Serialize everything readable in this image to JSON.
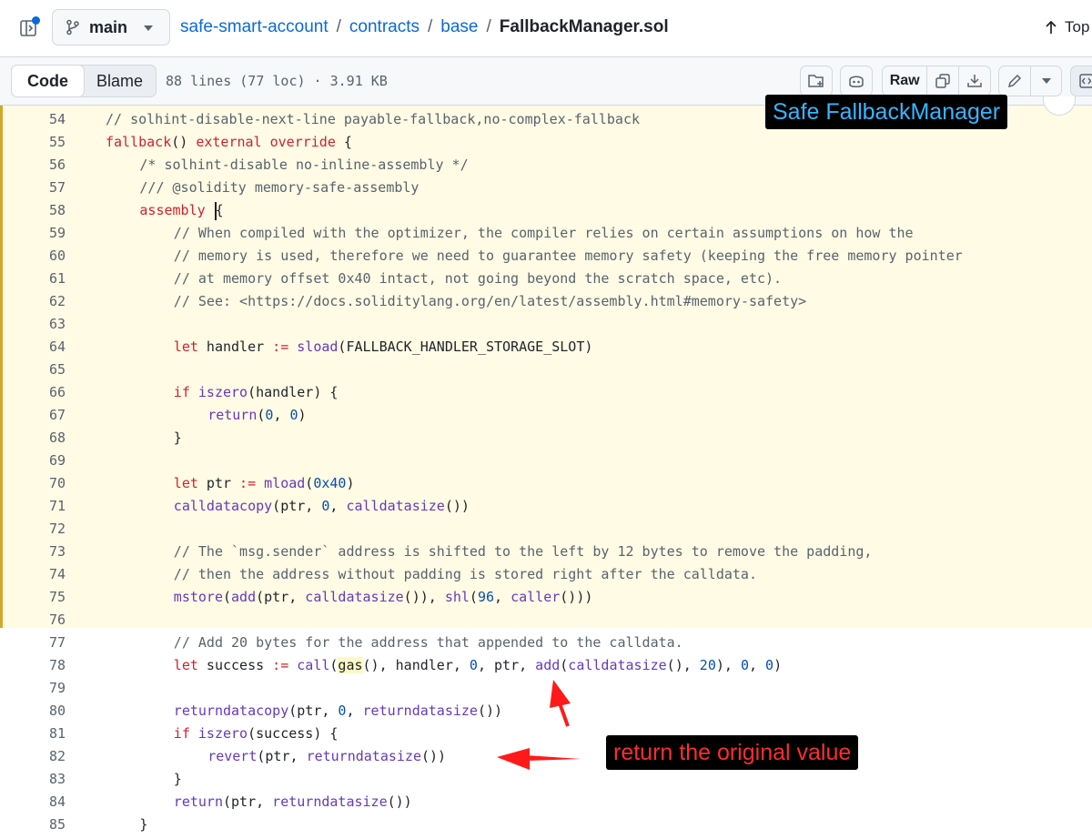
{
  "header": {
    "branch": "main",
    "breadcrumb": {
      "repo": "safe-smart-account",
      "folder1": "contracts",
      "folder2": "base",
      "file": "FallbackManager.sol",
      "sep": "/"
    },
    "top_label": "Top"
  },
  "toolbar": {
    "code_tab": "Code",
    "blame_tab": "Blame",
    "file_info": "88 lines (77 loc) · 3.91 KB",
    "raw_label": "Raw"
  },
  "annotations": {
    "title_tag": "Safe FallbackManager",
    "note_tag": "return the original value",
    "accent_blue": "#35b6ff",
    "accent_red": "#ff2d2d"
  },
  "code": {
    "highlight_color": "#fffbe5",
    "lines": [
      {
        "n": "54",
        "indent": 4,
        "tokens": [
          {
            "t": "// solhint-disable-next-line payable-fallback,no-complex-fallback",
            "c": "comment"
          }
        ]
      },
      {
        "n": "55",
        "indent": 4,
        "tokens": [
          {
            "t": "fallback",
            "c": "keyword"
          },
          {
            "t": "() ",
            "c": ""
          },
          {
            "t": "external",
            "c": "keyword"
          },
          {
            "t": " ",
            "c": ""
          },
          {
            "t": "override",
            "c": "keyword"
          },
          {
            "t": " {",
            "c": ""
          }
        ]
      },
      {
        "n": "56",
        "indent": 8,
        "tokens": [
          {
            "t": "/* solhint-disable no-inline-assembly */",
            "c": "comment"
          }
        ]
      },
      {
        "n": "57",
        "indent": 8,
        "tokens": [
          {
            "t": "/// @solidity memory-safe-assembly",
            "c": "comment"
          }
        ]
      },
      {
        "n": "58",
        "indent": 8,
        "tokens": [
          {
            "t": "assembly",
            "c": "keyword"
          },
          {
            "t": " ",
            "c": ""
          },
          {
            "t": "",
            "c": "cursor"
          },
          {
            "t": "{",
            "c": ""
          }
        ]
      },
      {
        "n": "59",
        "indent": 12,
        "tokens": [
          {
            "t": "// When compiled with the optimizer, the compiler relies on certain assumptions on how the",
            "c": "comment"
          }
        ]
      },
      {
        "n": "60",
        "indent": 12,
        "tokens": [
          {
            "t": "// memory is used, therefore we need to guarantee memory safety (keeping the free memory pointer",
            "c": "comment"
          }
        ]
      },
      {
        "n": "61",
        "indent": 12,
        "tokens": [
          {
            "t": "// at memory offset 0x40 intact, not going beyond the scratch space, etc).",
            "c": "comment"
          }
        ]
      },
      {
        "n": "62",
        "indent": 12,
        "tokens": [
          {
            "t": "// See: <https://docs.soliditylang.org/en/latest/assembly.html#memory-safety>",
            "c": "comment"
          }
        ]
      },
      {
        "n": "63",
        "indent": 0,
        "tokens": []
      },
      {
        "n": "64",
        "indent": 12,
        "tokens": [
          {
            "t": "let",
            "c": "keyword"
          },
          {
            "t": " handler ",
            "c": ""
          },
          {
            "t": ":=",
            "c": "op"
          },
          {
            "t": " ",
            "c": ""
          },
          {
            "t": "sload",
            "c": "func"
          },
          {
            "t": "(FALLBACK_HANDLER_STORAGE_SLOT)",
            "c": ""
          }
        ]
      },
      {
        "n": "65",
        "indent": 0,
        "tokens": []
      },
      {
        "n": "66",
        "indent": 12,
        "tokens": [
          {
            "t": "if",
            "c": "keyword"
          },
          {
            "t": " ",
            "c": ""
          },
          {
            "t": "iszero",
            "c": "func"
          },
          {
            "t": "(handler) {",
            "c": ""
          }
        ]
      },
      {
        "n": "67",
        "indent": 16,
        "tokens": [
          {
            "t": "return",
            "c": "func"
          },
          {
            "t": "(",
            "c": ""
          },
          {
            "t": "0",
            "c": "num"
          },
          {
            "t": ", ",
            "c": ""
          },
          {
            "t": "0",
            "c": "num"
          },
          {
            "t": ")",
            "c": ""
          }
        ]
      },
      {
        "n": "68",
        "indent": 12,
        "tokens": [
          {
            "t": "}",
            "c": ""
          }
        ]
      },
      {
        "n": "69",
        "indent": 0,
        "tokens": []
      },
      {
        "n": "70",
        "indent": 12,
        "tokens": [
          {
            "t": "let",
            "c": "keyword"
          },
          {
            "t": " ptr ",
            "c": ""
          },
          {
            "t": ":=",
            "c": "op"
          },
          {
            "t": " ",
            "c": ""
          },
          {
            "t": "mload",
            "c": "func"
          },
          {
            "t": "(",
            "c": ""
          },
          {
            "t": "0x40",
            "c": "num"
          },
          {
            "t": ")",
            "c": ""
          }
        ]
      },
      {
        "n": "71",
        "indent": 12,
        "tokens": [
          {
            "t": "calldatacopy",
            "c": "func"
          },
          {
            "t": "(ptr, ",
            "c": ""
          },
          {
            "t": "0",
            "c": "num"
          },
          {
            "t": ", ",
            "c": ""
          },
          {
            "t": "calldatasize",
            "c": "func"
          },
          {
            "t": "())",
            "c": ""
          }
        ]
      },
      {
        "n": "72",
        "indent": 0,
        "tokens": []
      },
      {
        "n": "73",
        "indent": 12,
        "tokens": [
          {
            "t": "// The `msg.sender` address is shifted to the left by 12 bytes to remove the padding,",
            "c": "comment"
          }
        ]
      },
      {
        "n": "74",
        "indent": 12,
        "tokens": [
          {
            "t": "// then the address without padding is stored right after the calldata.",
            "c": "comment"
          }
        ]
      },
      {
        "n": "75",
        "indent": 12,
        "tokens": [
          {
            "t": "mstore",
            "c": "func"
          },
          {
            "t": "(",
            "c": ""
          },
          {
            "t": "add",
            "c": "func"
          },
          {
            "t": "(ptr, ",
            "c": ""
          },
          {
            "t": "calldatasize",
            "c": "func"
          },
          {
            "t": "()), ",
            "c": ""
          },
          {
            "t": "shl",
            "c": "func"
          },
          {
            "t": "(",
            "c": ""
          },
          {
            "t": "96",
            "c": "num"
          },
          {
            "t": ", ",
            "c": ""
          },
          {
            "t": "caller",
            "c": "func"
          },
          {
            "t": "()))",
            "c": ""
          }
        ]
      },
      {
        "n": "76",
        "indent": 0,
        "tokens": []
      },
      {
        "n": "77",
        "indent": 12,
        "tokens": [
          {
            "t": "// Add 20 bytes for the address that appended to the calldata.",
            "c": "comment"
          }
        ]
      },
      {
        "n": "78",
        "indent": 12,
        "tokens": [
          {
            "t": "let",
            "c": "keyword"
          },
          {
            "t": " success ",
            "c": ""
          },
          {
            "t": ":=",
            "c": "op"
          },
          {
            "t": " ",
            "c": ""
          },
          {
            "t": "call",
            "c": "func"
          },
          {
            "t": "(",
            "c": ""
          },
          {
            "t": "gas",
            "c": "gas"
          },
          {
            "t": "(), handler, ",
            "c": ""
          },
          {
            "t": "0",
            "c": "num"
          },
          {
            "t": ", ptr, ",
            "c": ""
          },
          {
            "t": "add",
            "c": "func"
          },
          {
            "t": "(",
            "c": ""
          },
          {
            "t": "calldatasize",
            "c": "func"
          },
          {
            "t": "(), ",
            "c": ""
          },
          {
            "t": "20",
            "c": "num"
          },
          {
            "t": "), ",
            "c": ""
          },
          {
            "t": "0",
            "c": "num"
          },
          {
            "t": ", ",
            "c": ""
          },
          {
            "t": "0",
            "c": "num"
          },
          {
            "t": ")",
            "c": ""
          }
        ]
      },
      {
        "n": "79",
        "indent": 0,
        "tokens": []
      },
      {
        "n": "80",
        "indent": 12,
        "tokens": [
          {
            "t": "returndatacopy",
            "c": "func"
          },
          {
            "t": "(ptr, ",
            "c": ""
          },
          {
            "t": "0",
            "c": "num"
          },
          {
            "t": ", ",
            "c": ""
          },
          {
            "t": "returndatasize",
            "c": "func"
          },
          {
            "t": "())",
            "c": ""
          }
        ]
      },
      {
        "n": "81",
        "indent": 12,
        "tokens": [
          {
            "t": "if",
            "c": "keyword"
          },
          {
            "t": " ",
            "c": ""
          },
          {
            "t": "iszero",
            "c": "func"
          },
          {
            "t": "(success) {",
            "c": ""
          }
        ]
      },
      {
        "n": "82",
        "indent": 16,
        "tokens": [
          {
            "t": "revert",
            "c": "func"
          },
          {
            "t": "(ptr, ",
            "c": ""
          },
          {
            "t": "returndatasize",
            "c": "func"
          },
          {
            "t": "())",
            "c": ""
          }
        ]
      },
      {
        "n": "83",
        "indent": 12,
        "tokens": [
          {
            "t": "}",
            "c": ""
          }
        ]
      },
      {
        "n": "84",
        "indent": 12,
        "tokens": [
          {
            "t": "return",
            "c": "func"
          },
          {
            "t": "(ptr, ",
            "c": ""
          },
          {
            "t": "returndatasize",
            "c": "func"
          },
          {
            "t": "())",
            "c": ""
          }
        ]
      },
      {
        "n": "85",
        "indent": 8,
        "tokens": [
          {
            "t": "}",
            "c": ""
          }
        ]
      }
    ]
  }
}
